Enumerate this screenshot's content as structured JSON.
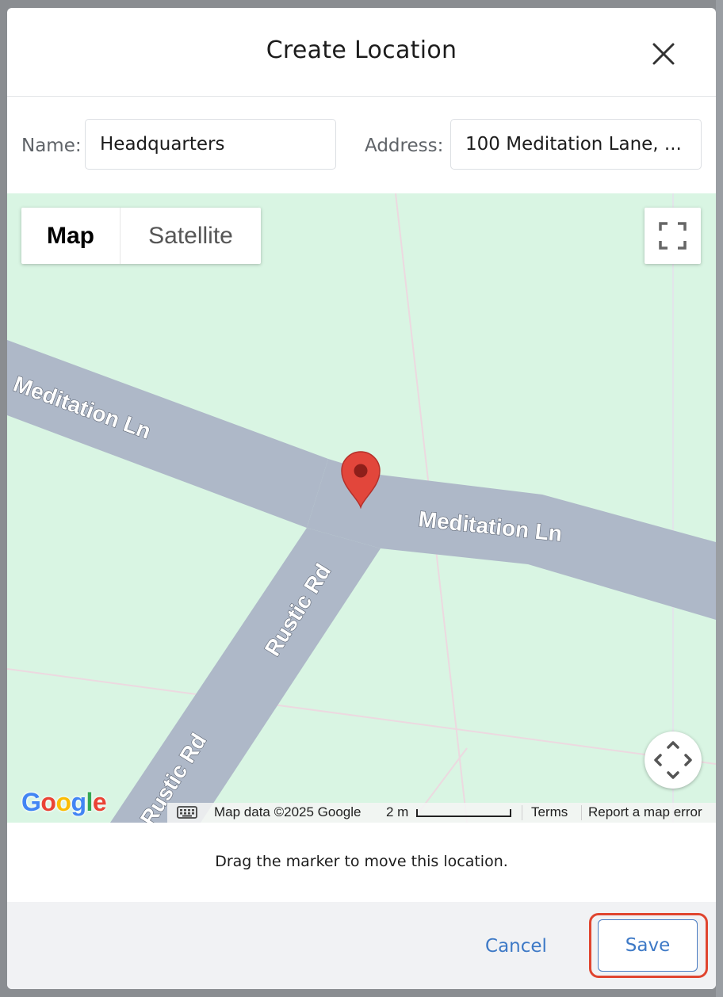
{
  "dialog": {
    "title": "Create Location",
    "close_icon": "close-icon"
  },
  "form": {
    "name_label": "Name:",
    "name_value": "Headquarters",
    "address_label": "Address:",
    "address_value": "100 Meditation Lane, ..."
  },
  "map": {
    "type_options": [
      "Map",
      "Satellite"
    ],
    "selected_type": "Map",
    "roads": {
      "meditation_left": "Meditation Ln",
      "meditation_right": "Meditation Ln",
      "rustic_upper": "Rustic Rd",
      "rustic_lower": "Rustic Rd"
    },
    "logo": "Google",
    "attribution": {
      "map_data": "Map data ©2025 Google",
      "scale": "2 m",
      "terms": "Terms",
      "report": "Report a map error"
    },
    "icons": {
      "fullscreen": "fullscreen-icon",
      "camera": "camera-control-icon",
      "keyboard": "keyboard-icon",
      "marker": "map-marker-icon"
    },
    "colors": {
      "land": "#d9f5e3",
      "road": "#aeb8c8",
      "marker": "#e2463b"
    }
  },
  "hint": "Drag the marker to move this location.",
  "footer": {
    "cancel_label": "Cancel",
    "save_label": "Save",
    "accent": "#3d79c6",
    "highlight": "#e0452f"
  }
}
